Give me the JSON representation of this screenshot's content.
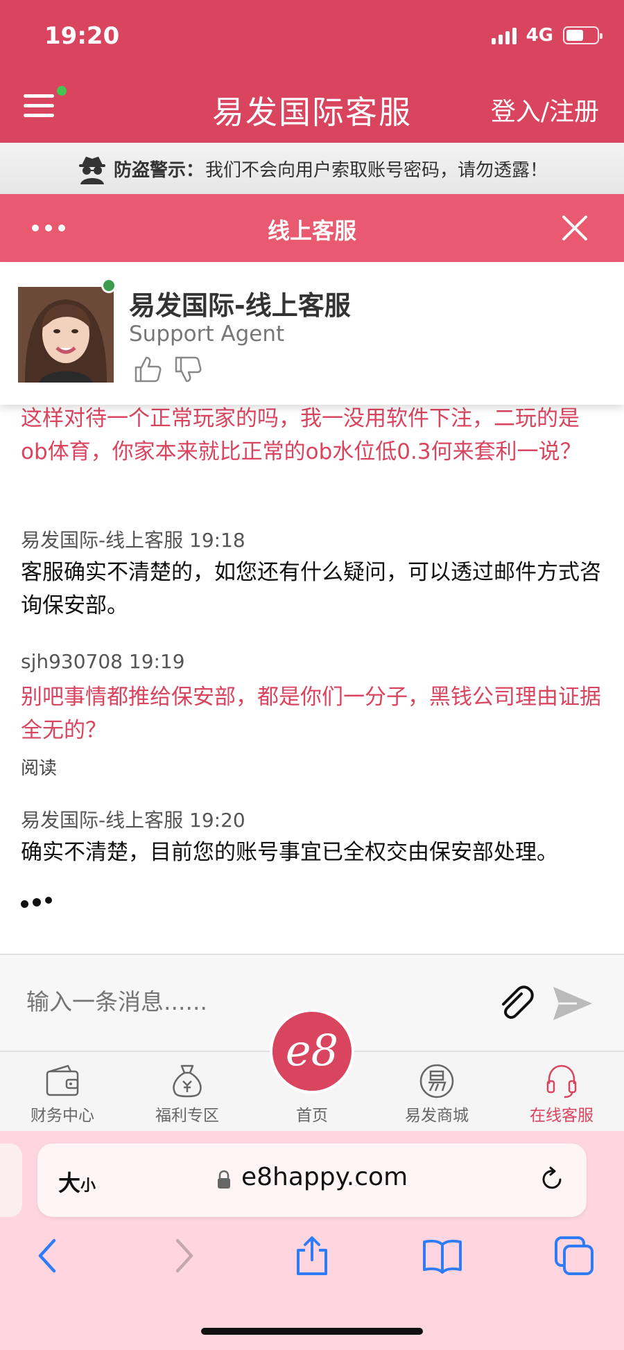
{
  "status_bar": {
    "time": "19:20",
    "network": "4G"
  },
  "header": {
    "title": "易发国际客服",
    "login_label": "登入/注册"
  },
  "warning": {
    "title": "防盗警示：",
    "text": "我们不会向用户索取账号密码，请勿透露！"
  },
  "chat_header": {
    "title": "线上客服"
  },
  "agent": {
    "name": "易发国际-线上客服",
    "role": "Support Agent"
  },
  "messages": [
    {
      "sender": "user",
      "text": "这样对待一个正常玩家的吗，我一没用软件下注，二玩的是ob体育，你家本来就比正常的ob水位低0.3何来套利一说？"
    },
    {
      "sender": "agent",
      "meta": "易发国际-线上客服 19:18",
      "text": "客服确实不清楚的，如您还有什么疑问，可以透过邮件方式咨询保安部。"
    },
    {
      "sender": "user",
      "meta": "sjh930708 19:19",
      "text": "别吧事情都推给保安部，都是你们一分子，黑钱公司理由证据全无的？",
      "status": "阅读"
    },
    {
      "sender": "agent",
      "meta": "易发国际-线上客服 19:20",
      "text": "确实不清楚，目前您的账号事宜已全权交由保安部处理。"
    }
  ],
  "composer": {
    "placeholder": "输入一条消息......"
  },
  "tabbar": {
    "items": [
      {
        "label": "财务中心",
        "icon": "wallet-icon"
      },
      {
        "label": "福利专区",
        "icon": "money-bag-icon"
      },
      {
        "label": "首页",
        "icon": "e8-logo"
      },
      {
        "label": "易发商城",
        "icon": "mall-icon"
      },
      {
        "label": "在线客服",
        "icon": "headset-icon"
      }
    ],
    "home_logo": "e8"
  },
  "browser": {
    "text_size_label": "大",
    "text_size_small": "小",
    "url": "e8happy.com"
  },
  "colors": {
    "brand": "#d9445f",
    "chat_header": "#e9596f",
    "browser_bg": "#ffd6df",
    "nav_blue": "#2f7cf6"
  }
}
